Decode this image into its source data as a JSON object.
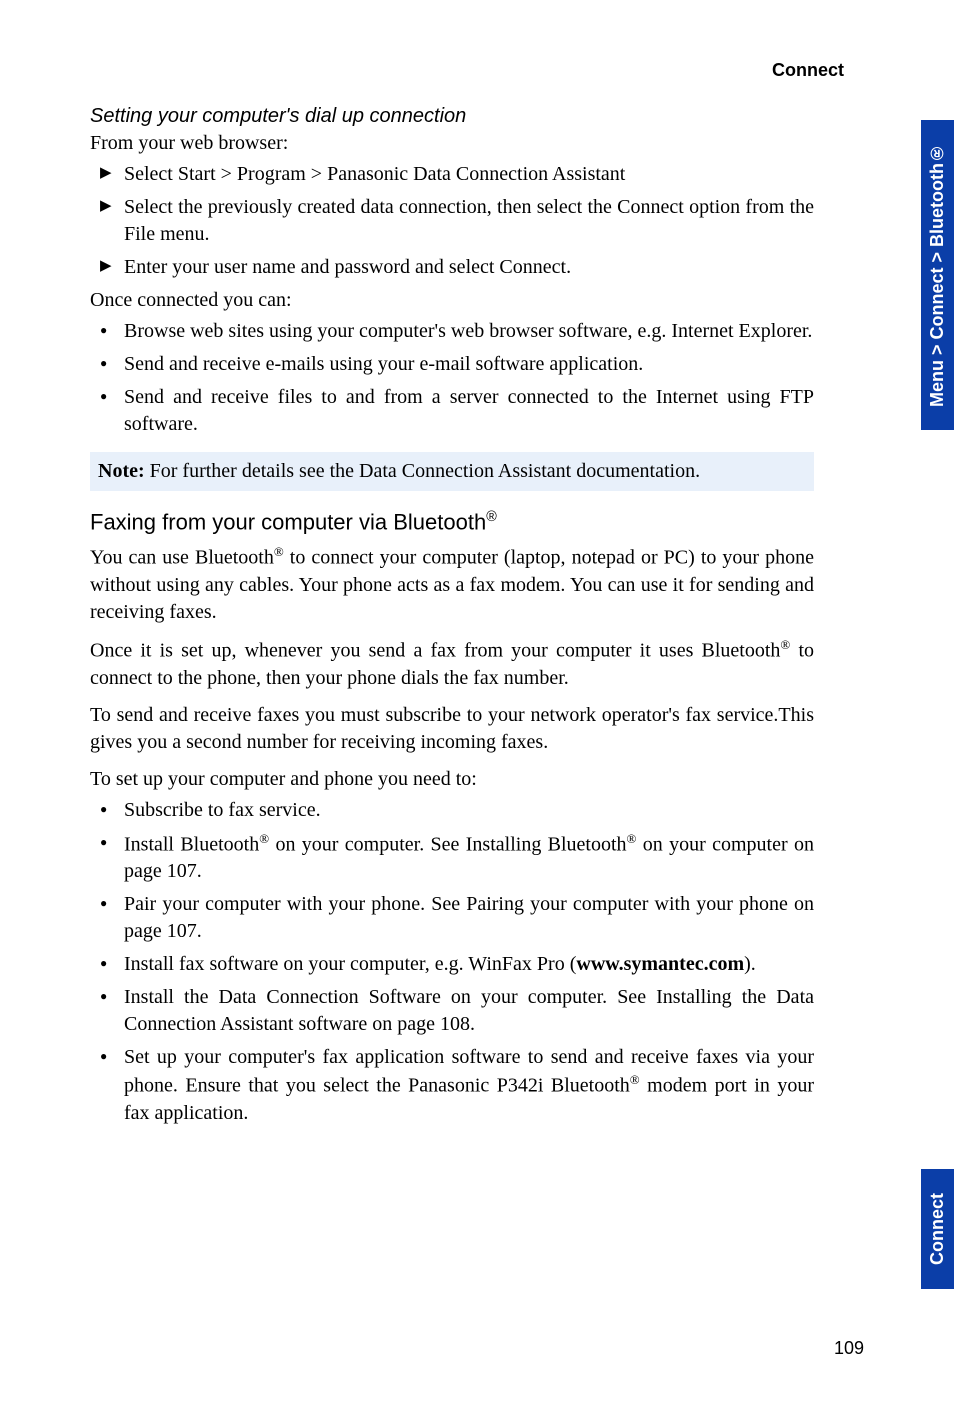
{
  "header": {
    "title": "Connect"
  },
  "sideTabs": {
    "top": "Menu > Connect > Bluetooth®",
    "bottom": "Connect"
  },
  "pageNumber": "109",
  "sub1": {
    "title": "Setting your computer's dial up connection",
    "intro": "From your web browser:",
    "arrows": [
      "Select Start > Program > Panasonic Data Connection Assistant",
      "Select the previously created data connection, then select the Connect option from the File menu.",
      "Enter your user name and password and select Connect."
    ],
    "once": "Once connected you can:",
    "bullets": [
      "Browse web sites using your computer's web browser software, e.g. Internet Explorer.",
      "Send and receive e-mails using your e-mail software application.",
      "Send and receive files to and from a server connected to the Internet using FTP software."
    ]
  },
  "note": {
    "label": "Note:",
    "text": " For further details see the Data Connection Assistant documentation."
  },
  "sec2": {
    "title_a": "Faxing from your computer via Bluetooth",
    "p1_a": "You can use Bluetooth",
    "p1_b": " to connect your computer (laptop, notepad or PC) to your phone without using any cables. Your phone acts as a fax modem. You can use it for sending and receiving faxes.",
    "p2_a": "Once it is set up, whenever you send a fax from your computer it uses Bluetooth",
    "p2_b": " to connect to the phone, then your phone dials the fax number.",
    "p3": "To send and receive faxes you must subscribe to your network operator's fax service.This gives you a second number for receiving incoming faxes.",
    "p4": "To set up your computer and phone you need to:",
    "b1": "Subscribe to fax service.",
    "b2_a": "Install Bluetooth",
    "b2_b": " on your computer. See Installing Bluetooth",
    "b2_c": " on your computer on page 107.",
    "b3": "Pair your computer with your phone. See Pairing your computer with your phone on page 107.",
    "b4_a": "Install fax software on your computer, e.g. WinFax Pro (",
    "b4_link": "www.symantec.com",
    "b4_b": ").",
    "b5": "Install the Data Connection Software on your computer. See Installing the Data Connection Assistant software on page 108.",
    "b6_a": "Set up your computer's fax application software to send and receive faxes via your phone. Ensure that you select the Panasonic P342i Bluetooth",
    "b6_b": " modem port in your fax application."
  },
  "reg": "®"
}
